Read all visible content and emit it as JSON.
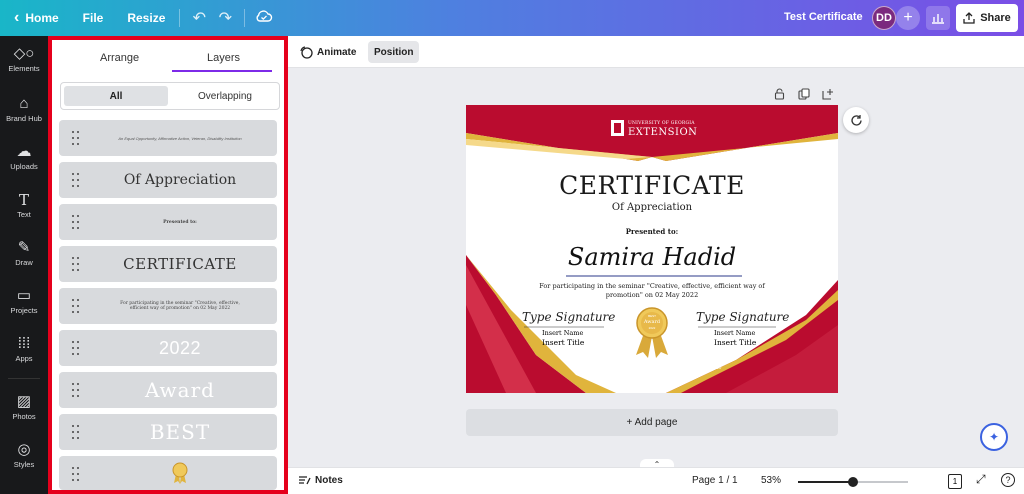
{
  "topbar": {
    "home_label": "Home",
    "file_label": "File",
    "resize_label": "Resize",
    "doc_title": "Test Certificate",
    "avatar_initials": "DD",
    "share_label": "Share",
    "gradient": [
      "#19b6c8",
      "#7a4ee6"
    ]
  },
  "rail": {
    "items": [
      {
        "label": "Elements",
        "icon": "elements-icon"
      },
      {
        "label": "Brand Hub",
        "icon": "brand-hub-icon"
      },
      {
        "label": "Uploads",
        "icon": "upload-cloud-icon"
      },
      {
        "label": "Text",
        "icon": "text-t-icon"
      },
      {
        "label": "Draw",
        "icon": "draw-pen-icon"
      },
      {
        "label": "Projects",
        "icon": "folder-icon"
      },
      {
        "label": "Apps",
        "icon": "apps-grid-icon"
      },
      {
        "label": "Photos",
        "icon": "photo-icon"
      },
      {
        "label": "Styles",
        "icon": "palette-icon"
      }
    ]
  },
  "panel": {
    "tab_arrange": "Arrange",
    "tab_layers": "Layers",
    "filter_all": "All",
    "filter_overlapping": "Overlapping",
    "highlight_color": "#e5001c",
    "layers": [
      {
        "text": "An Equal Opportunity, Affirmative Action, Veteran, Disability Institution"
      },
      {
        "text": "Of Appreciation"
      },
      {
        "text": "Presented to:"
      },
      {
        "text": "CERTIFICATE"
      },
      {
        "text": "For participating in the seminar \"Creative, effective, efficient way of promotion\" on 02 May 2022"
      },
      {
        "text": "2022"
      },
      {
        "text": "Award"
      },
      {
        "text": "BEST"
      },
      {
        "text": ""
      }
    ]
  },
  "context_toolbar": {
    "animate_label": "Animate",
    "position_label": "Position"
  },
  "certificate": {
    "org_line1": "UNIVERSITY OF GEORGIA",
    "org_line2": "EXTENSION",
    "title": "CERTIFICATE",
    "subtitle": "Of Appreciation",
    "presented": "Presented to:",
    "recipient": "Samira Hadid",
    "body_line1": "For participating in the seminar \"Creative, effective, efficient way of",
    "body_line2": "promotion\" on 02 May 2022",
    "sig_script": "Type Signature",
    "sig_name": "Insert Name",
    "sig_title": "Insert Title",
    "medal_top": "BEST",
    "medal_mid": "Award",
    "medal_year": "2022",
    "footer": "An Equal Opportunity, Affirmative Action, Veteran, Disability Institution",
    "red": "#ba0c2f",
    "gold": "#e0b43c"
  },
  "canvas": {
    "add_page_label": "+ Add page"
  },
  "bottombar": {
    "notes_label": "Notes",
    "page_label": "Page 1 / 1",
    "zoom_label": "53%",
    "zoom_value": 53,
    "pages_count": "1"
  }
}
